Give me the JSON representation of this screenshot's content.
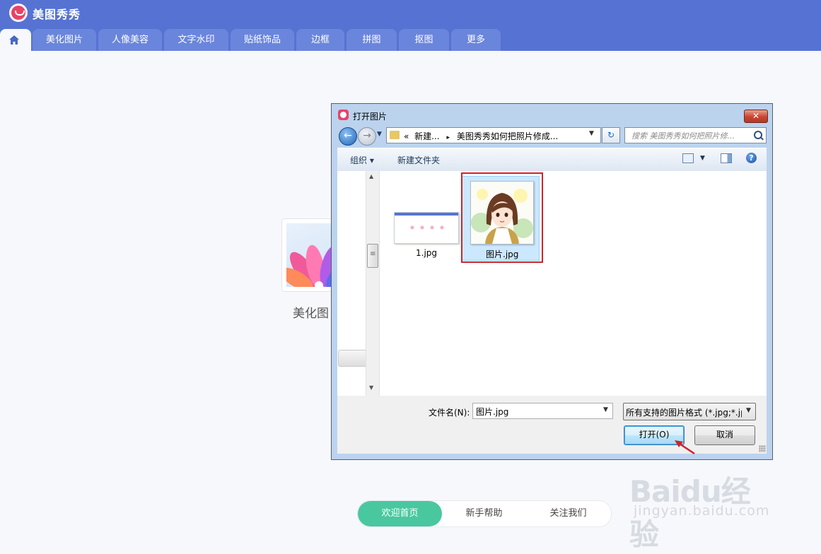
{
  "app": {
    "title": "美图秀秀",
    "tabs": [
      "美化图片",
      "人像美容",
      "文字水印",
      "贴纸饰品",
      "边框",
      "拼图",
      "抠图",
      "更多"
    ]
  },
  "welcome": {
    "feature_label": "美化图"
  },
  "bottom_nav": {
    "items": [
      "欢迎首页",
      "新手帮助",
      "关注我们"
    ],
    "active": "欢迎首页"
  },
  "watermark": {
    "brand": "Baidu经验",
    "url": "jingyan.baidu.com"
  },
  "dialog": {
    "title": "打开图片",
    "close_glyph": "✕",
    "address": {
      "prefix": "«",
      "segment1": "新建...",
      "separator": "▸",
      "segment2": "美图秀秀如何把照片修成..."
    },
    "search_placeholder": "搜索 美图秀秀如何把照片修...",
    "toolbar": {
      "organize": "组织 ▾",
      "new_folder": "新建文件夹",
      "help": "?"
    },
    "files": [
      {
        "name": "1.jpg",
        "selected": false
      },
      {
        "name": "图片.jpg",
        "selected": true
      }
    ],
    "footer": {
      "filename_label": "文件名(N):",
      "filename_value": "图片.jpg",
      "filter_value": "所有支持的图片格式 (*.jpg;*.jp",
      "open_button": "打开(O)",
      "cancel_button": "取消"
    }
  },
  "colors": {
    "app_header": "#5673d3",
    "tab_bg": "#6a85dc",
    "active_nav": "#49c8a0",
    "brand_pink": "#e8436a",
    "highlight_red": "#d3212a"
  }
}
